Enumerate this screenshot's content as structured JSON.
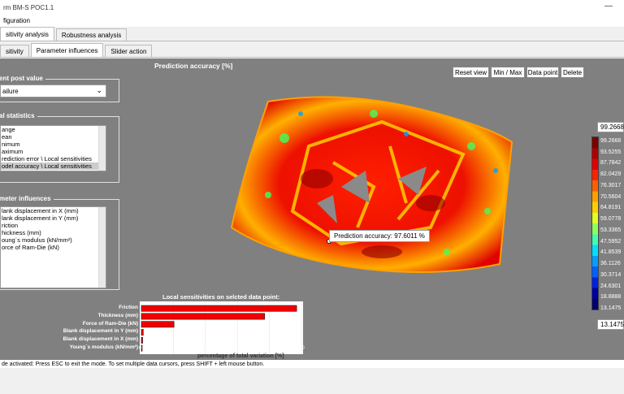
{
  "window": {
    "title": "rm BM-S POC1.1",
    "minimize_glyph": "—"
  },
  "menu": {
    "items": [
      "figuration"
    ]
  },
  "tabs_top": [
    "sitivity analysis",
    "Robustness analysis"
  ],
  "tabs_sub": [
    "sitivity",
    "Parameter influences",
    "Slider action"
  ],
  "groups": {
    "post_value": {
      "title": "ent post value",
      "selected": "ailure"
    },
    "statistics": {
      "title": "al statistics",
      "items": [
        "ange",
        "ean",
        "nimum",
        "aximum",
        "rediction error \\ Local sensitivities",
        "odel accuracy \\ Local sensitivities"
      ],
      "selected_index": 5
    },
    "parameters": {
      "title": "meter influences",
      "items": [
        "lank displacement in X (mm)",
        "lank displacement in Y (mm)",
        "riction",
        "hickness (mm)",
        "oung´s modulus (kN/mm²)",
        "orce of Ram-Die (kN)"
      ]
    }
  },
  "plot": {
    "title": "Prediction accuracy [%]",
    "buttons": [
      "Reset view",
      "Min / Max",
      "Data point",
      "Delete"
    ],
    "tooltip": "Prediction accuracy: 97.6011 %",
    "colorbar": {
      "max_box": "99.2668",
      "min_box": "13.1475",
      "ticks": [
        "99.2668",
        "93.5255",
        "87.7842",
        "82.0429",
        "76.3017",
        "70.5604",
        "64.8191",
        "59.0778",
        "53.3365",
        "47.5952",
        "41.8539",
        "36.1126",
        "30.3714",
        "24.6301",
        "18.8888",
        "13.1475"
      ],
      "colors": [
        "#7a0000",
        "#b00000",
        "#e00000",
        "#ff2000",
        "#ff6000",
        "#ffa000",
        "#ffd000",
        "#e0ff20",
        "#90ff60",
        "#40ffb0",
        "#00e0ff",
        "#00a0ff",
        "#0060ff",
        "#0020e0",
        "#0000a0",
        "#00006a"
      ]
    }
  },
  "chart_data": {
    "type": "bar",
    "title": "Local sensitivities on selcted data point:",
    "categories": [
      "Friction",
      "Thickness (mm)",
      "Force of Ram-Die (kN)",
      "Blank displacement in Y (mm)",
      "Blank displacement in X (mm)",
      "Young´s modulus (kN/mm²)"
    ],
    "values": [
      48.5,
      38.5,
      10.2,
      0.6,
      0.4,
      0.1
    ],
    "xlim": [
      0,
      50
    ],
    "xticks": [
      "0",
      "10",
      "20",
      "30",
      "40",
      "50"
    ],
    "xlabel": "percentage of total variation [%]",
    "bar_color": "#ee0000"
  },
  "status": {
    "text": "de activated: Press ESC to exit the mode. To set multiple data cursors, press SHIFT + left mouse button."
  }
}
